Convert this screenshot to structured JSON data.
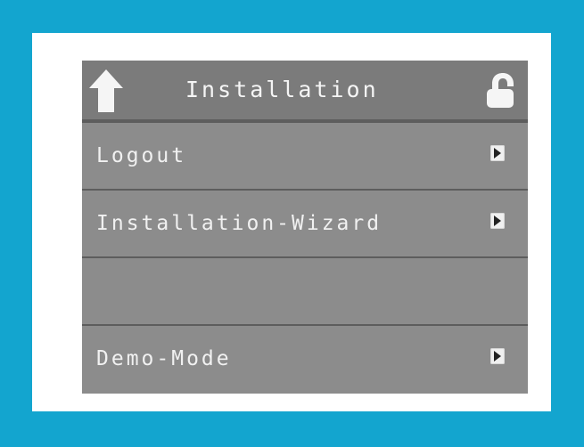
{
  "header": {
    "title": "Installation",
    "back_icon": "up-arrow-icon",
    "lock_icon": "lock-open-icon"
  },
  "menu": {
    "items": [
      {
        "label": "Logout",
        "icon": "chevron-right-icon"
      },
      {
        "label": "Installation-Wizard",
        "icon": "chevron-right-icon"
      },
      {
        "label": "",
        "icon": ""
      },
      {
        "label": "Demo-Mode",
        "icon": "chevron-right-icon"
      }
    ]
  },
  "colors": {
    "frame": "#13a5cf",
    "panel": "#ffffff",
    "screen": "#8c8c8c",
    "header": "#7b7b7b",
    "text": "#f1f1f1"
  }
}
